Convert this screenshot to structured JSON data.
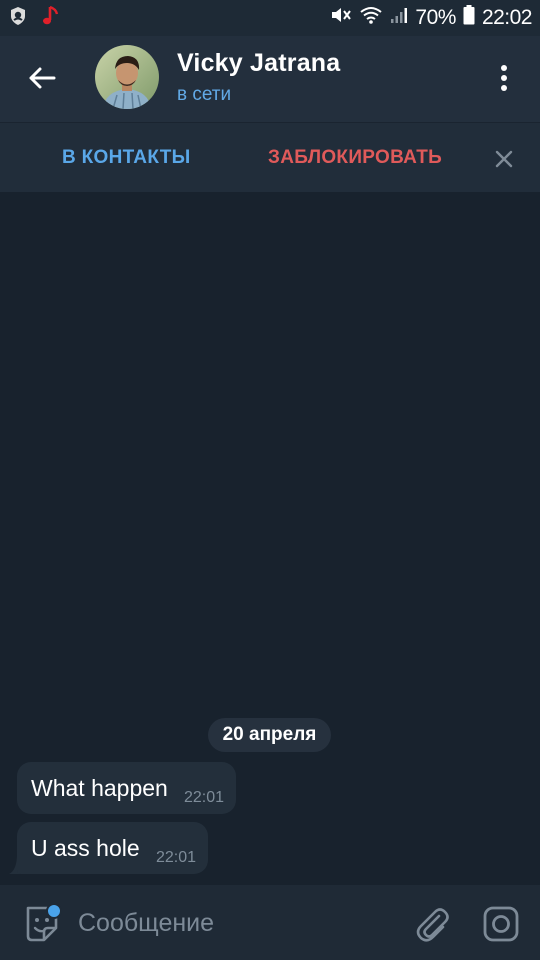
{
  "status_bar": {
    "battery_percent": "70%",
    "time": "22:02",
    "icons": [
      "shield-app-icon",
      "music-note-icon",
      "mute-icon",
      "wifi-icon",
      "signal-icon",
      "battery-icon"
    ]
  },
  "header": {
    "contact_name": "Vicky Jatrana",
    "contact_status": "в сети",
    "icons": [
      "back-arrow-icon",
      "avatar",
      "more-vertical-icon"
    ]
  },
  "action_bar": {
    "add_contact_label": "В КОНТАКТЫ",
    "block_label": "ЗАБЛОКИРОВАТЬ",
    "close_icon": "close-icon"
  },
  "chat": {
    "date_label": "20 апреля",
    "messages": [
      {
        "text": "What happen",
        "time": "22:01"
      },
      {
        "text": "U ass hole",
        "time": "22:01"
      }
    ]
  },
  "composer": {
    "placeholder": "Сообщение",
    "icons": [
      "sticker-icon",
      "attach-icon",
      "camera-icon"
    ]
  },
  "colors": {
    "background": "#18222d",
    "header": "#232f3d",
    "accent_blue": "#5aa7e8",
    "danger_red": "#e05a5a",
    "bubble": "#232f3b"
  }
}
